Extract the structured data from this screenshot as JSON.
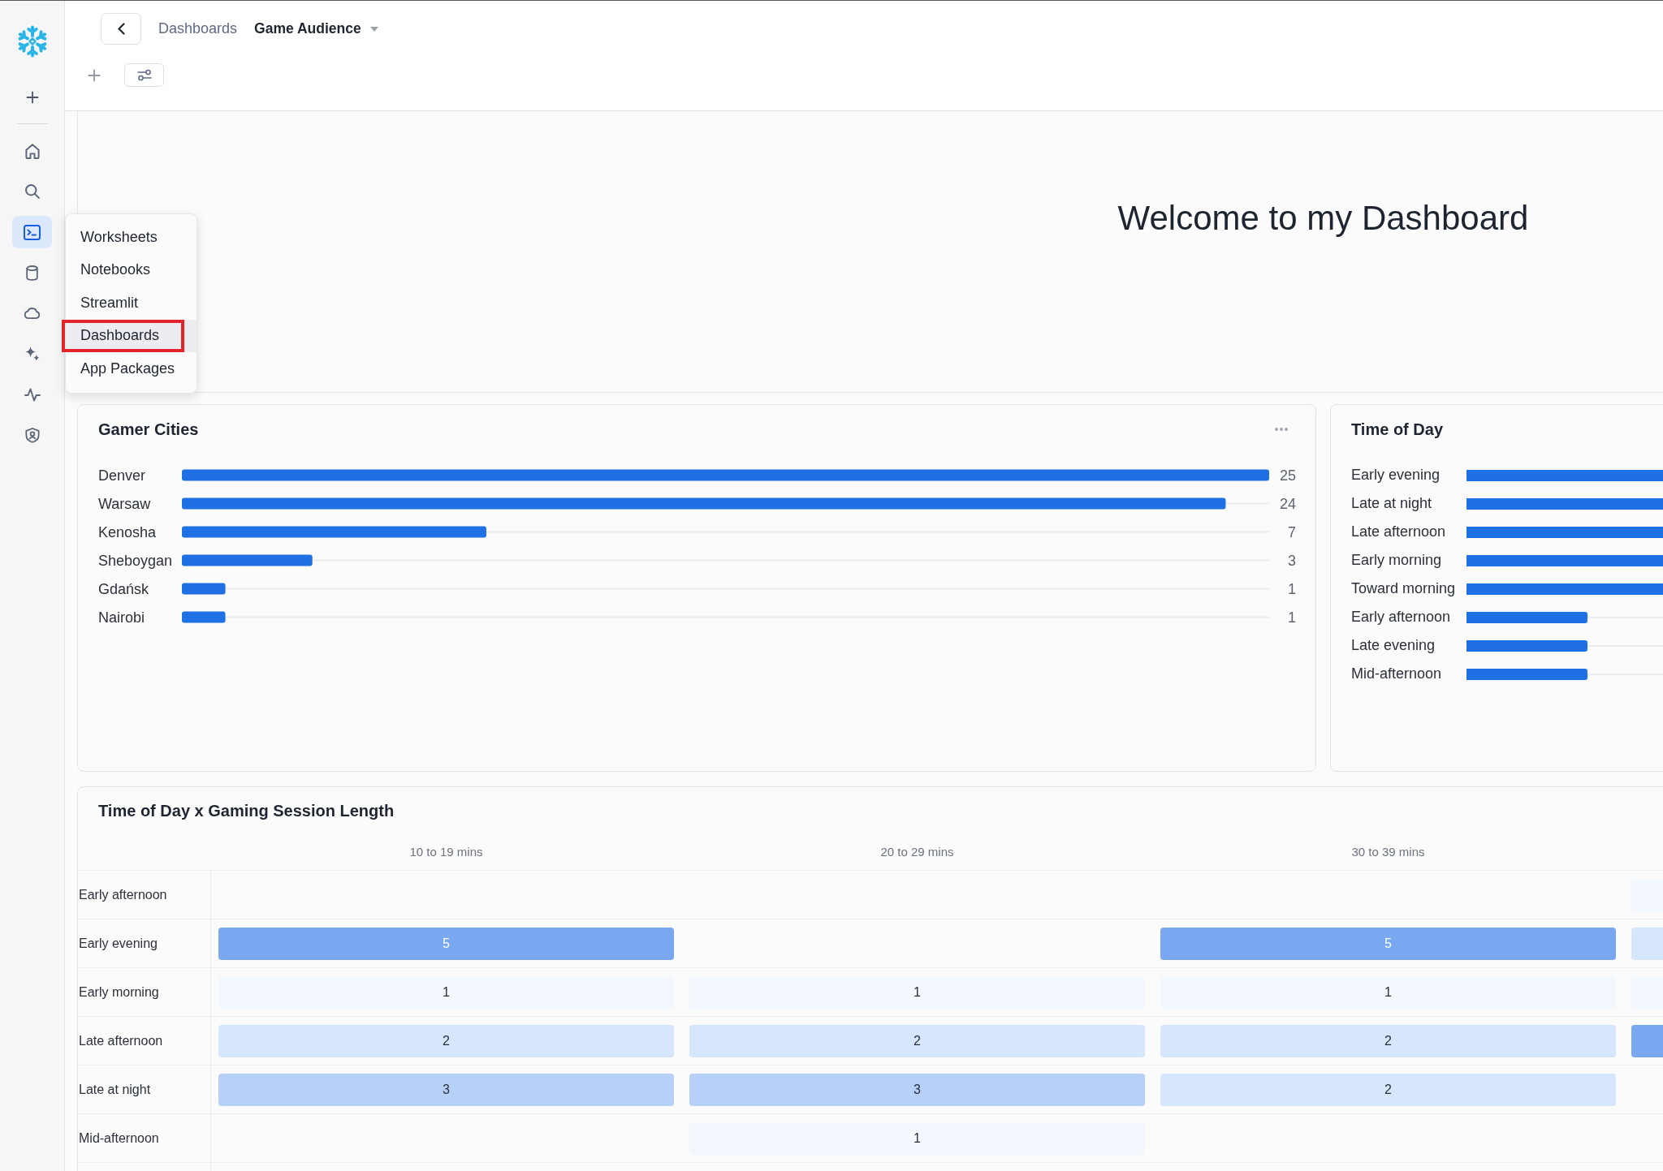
{
  "sidebar": {
    "items": [
      {
        "selected": false
      },
      {
        "selected": false
      },
      {
        "selected": true
      },
      {
        "selected": false
      },
      {
        "selected": false
      },
      {
        "selected": false
      },
      {
        "selected": false
      },
      {
        "selected": false
      }
    ]
  },
  "header": {
    "breadcrumb": "Dashboards",
    "title": "Game Audience"
  },
  "nav_menu": {
    "items": [
      {
        "label": "Worksheets",
        "selected": false,
        "outlined": false
      },
      {
        "label": "Notebooks",
        "selected": false,
        "outlined": false
      },
      {
        "label": "Streamlit",
        "selected": false,
        "outlined": false
      },
      {
        "label": "Dashboards",
        "selected": true,
        "outlined": true
      },
      {
        "label": "App Packages",
        "selected": false,
        "outlined": false
      }
    ]
  },
  "welcome_tile": {
    "text": "Welcome to my Dashboard"
  },
  "gamer_cities": {
    "title": "Gamer Cities",
    "chart_data": {
      "type": "bar",
      "orientation": "horizontal",
      "categories": [
        "Denver",
        "Warsaw",
        "Kenosha",
        "Sheboygan",
        "Gdańsk",
        "Nairobi"
      ],
      "values": [
        25,
        24,
        7,
        3,
        1,
        1
      ],
      "data_labels": true
    }
  },
  "time_of_day": {
    "title": "Time of Day",
    "bars": [
      {
        "label": "Early evening",
        "level": 1
      },
      {
        "label": "Late at night",
        "level": 1
      },
      {
        "label": "Late afternoon",
        "level": 1
      },
      {
        "label": "Early morning",
        "level": 1
      },
      {
        "label": "Toward morning",
        "level": 1
      },
      {
        "label": "Early afternoon",
        "level": 0.115
      },
      {
        "label": "Late evening",
        "level": 0.115
      },
      {
        "label": "Mid-afternoon",
        "level": 0.115
      }
    ]
  },
  "session_heatmap": {
    "title": "Time of Day x Gaming Session Length",
    "columns": [
      "10 to 19 mins",
      "20 to 29 mins",
      "30 to 39 mins"
    ],
    "rows": [
      {
        "label": "Early afternoon",
        "cells": [
          null,
          null,
          null,
          {
            "color": "#f3f8ff"
          }
        ]
      },
      {
        "label": "Early evening",
        "cells": [
          {
            "value": "5",
            "color": "#7aa8f0"
          },
          null,
          {
            "value": "5",
            "color": "#7aa8f0"
          },
          {
            "color": "#d6e6fc"
          }
        ]
      },
      {
        "label": "Early morning",
        "cells": [
          {
            "value": "1",
            "color": "#f3f8ff"
          },
          {
            "value": "1",
            "color": "#f3f8ff"
          },
          {
            "value": "1",
            "color": "#f3f8ff"
          },
          {
            "color": "#f3f8ff"
          }
        ]
      },
      {
        "label": "Late afternoon",
        "cells": [
          {
            "value": "2",
            "color": "#d6e6fc"
          },
          {
            "value": "2",
            "color": "#d6e6fc"
          },
          {
            "value": "2",
            "color": "#d6e6fc"
          },
          {
            "color": "#7aa8f0"
          }
        ]
      },
      {
        "label": "Late at night",
        "cells": [
          {
            "value": "3",
            "color": "#b7d0f7"
          },
          {
            "value": "3",
            "color": "#b7d0f7"
          },
          {
            "value": "2",
            "color": "#d6e6fc"
          },
          null
        ]
      },
      {
        "label": "Mid-afternoon",
        "cells": [
          null,
          {
            "value": "1",
            "color": "#f3f8ff"
          },
          null,
          null
        ]
      }
    ]
  }
}
